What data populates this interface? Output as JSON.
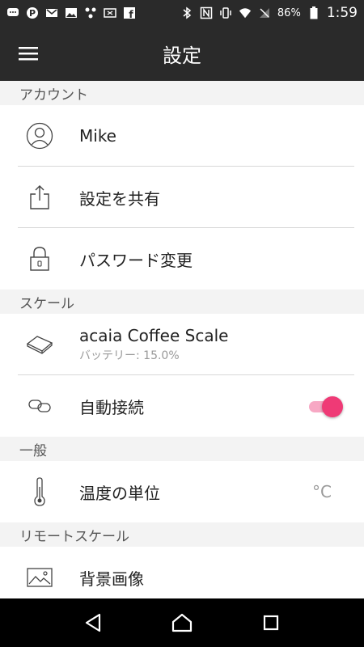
{
  "status_bar": {
    "battery": "86%",
    "time": "1:59"
  },
  "app_bar": {
    "title": "設定"
  },
  "sections": {
    "account": {
      "header": "アカウント",
      "user_name": "Mike",
      "share_settings": "設定を共有",
      "change_password": "パスワード変更"
    },
    "scale": {
      "header": "スケール",
      "device_name": "acaia Coffee Scale",
      "battery": "バッテリー: 15.0%",
      "auto_connect": "自動接続",
      "auto_connect_on": true
    },
    "general": {
      "header": "一般",
      "temperature_unit": "温度の単位",
      "temperature_value": "°C"
    },
    "remote_scale": {
      "header": "リモートスケール",
      "background_image": "背景画像"
    }
  },
  "colors": {
    "bar_background": "#2a2a2a",
    "accent": "#ef3a76",
    "accent_track": "#f7a8c4",
    "section_header_bg": "#f3f3f3"
  }
}
